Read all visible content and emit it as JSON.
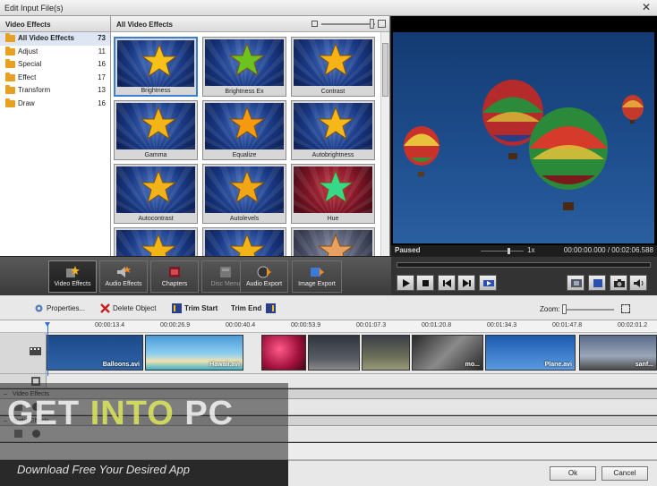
{
  "window": {
    "title": "Edit Input File(s)",
    "close_glyph": "✕"
  },
  "categories": {
    "header": "Video Effects",
    "items": [
      {
        "label": "All Video Effects",
        "count": "73"
      },
      {
        "label": "Adjust",
        "count": "11"
      },
      {
        "label": "Special",
        "count": "16"
      },
      {
        "label": "Effect",
        "count": "17"
      },
      {
        "label": "Transform",
        "count": "13"
      },
      {
        "label": "Draw",
        "count": "16"
      }
    ]
  },
  "effects": {
    "header": "All Video Effects",
    "tiles": [
      {
        "label": "Brightness",
        "star": "#f6c21a",
        "bg": "blue"
      },
      {
        "label": "Brightness Ex",
        "star": "#6cc21e",
        "bg": "blue"
      },
      {
        "label": "Contrast",
        "star": "#f7b215",
        "bg": "blue"
      },
      {
        "label": "Gamma",
        "star": "#f3b417",
        "bg": "blue"
      },
      {
        "label": "Equalize",
        "star": "#f59a10",
        "bg": "blue"
      },
      {
        "label": "Autobrightness",
        "star": "#f6b818",
        "bg": "blue"
      },
      {
        "label": "Autocontrast",
        "star": "#f2b21a",
        "bg": "blue"
      },
      {
        "label": "Autolevels",
        "star": "#f0a615",
        "bg": "blue"
      },
      {
        "label": "Hue",
        "star": "#37d988",
        "bg": "red"
      },
      {
        "label": "",
        "star": "#f3b418",
        "bg": "blue"
      },
      {
        "label": "",
        "star": "#f3b418",
        "bg": "blue"
      },
      {
        "label": "",
        "star": "#e8a060",
        "bg": "grey"
      }
    ]
  },
  "preview": {
    "status": "Paused",
    "speed": "1x",
    "time": "00:00:00.000 / 00:02:06.588"
  },
  "toolbar": {
    "video_effects": "Video Effects",
    "audio_effects": "Audio Effects",
    "chapters": "Chapters",
    "disc_menu": "Disc Menu",
    "audio_export": "Audio Export",
    "image_export": "Image Export"
  },
  "timeline": {
    "properties": "Properties...",
    "delete_object": "Delete Object",
    "trim_start": "Trim Start",
    "trim_end": "Trim End",
    "zoom": "Zoom:",
    "ticks": [
      "00:00:13.4",
      "00:00:26.9",
      "00:00:40.4",
      "00:00:53.9",
      "00:01:07.3",
      "00:01:20.8",
      "00:01:34.3",
      "00:01:47.8",
      "00:02:01.2"
    ],
    "clips": [
      {
        "name": "Balloons.avi",
        "theme": "balloons"
      },
      {
        "name": "Hawaii.avi",
        "theme": "beach"
      },
      {
        "name": "",
        "theme": "flowers"
      },
      {
        "name": "",
        "theme": "night"
      },
      {
        "name": "",
        "theme": "field"
      },
      {
        "name": "mo...",
        "theme": "rock"
      },
      {
        "name": "Plane.avi",
        "theme": "sky"
      },
      {
        "name": "sanf...",
        "theme": "city"
      }
    ],
    "video_effects_section": "Video Effects",
    "audio_effects_section": "Audio Effects"
  },
  "watermark": {
    "get": "GET ",
    "into": "INTO",
    "pc": " PC",
    "tagline": "Download Free Your Desired App"
  },
  "buttons": {
    "ok": "Ok",
    "cancel": "Cancel"
  }
}
